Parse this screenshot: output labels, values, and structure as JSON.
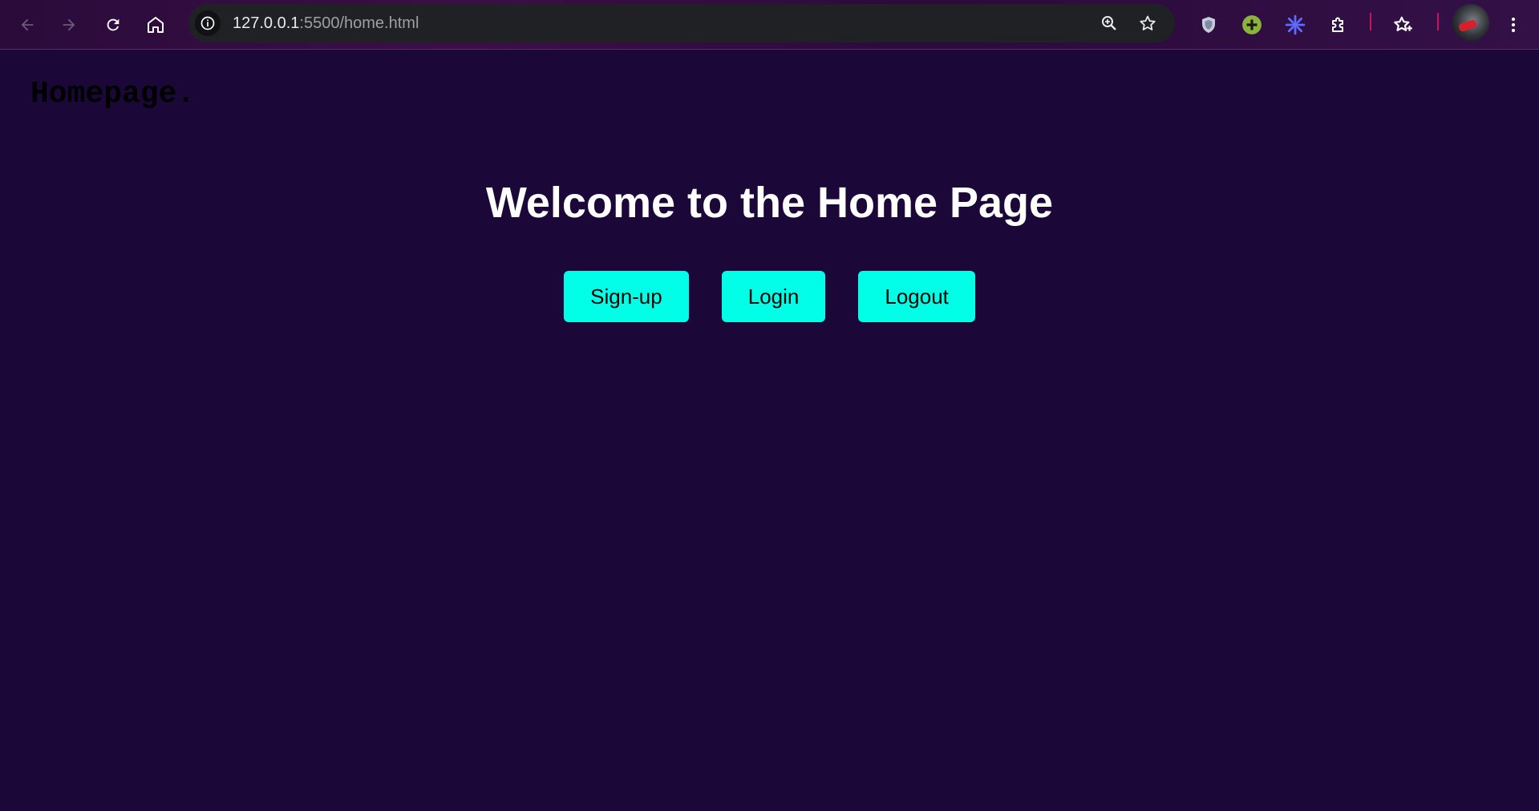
{
  "browser": {
    "url_host": "127.0.0.1",
    "url_path": ":5500/home.html",
    "icons": [
      "back-icon",
      "forward-icon",
      "reload-icon",
      "home-icon",
      "site-info-icon",
      "zoom-icon",
      "bookmark-star-icon",
      "shield-extension-icon",
      "plus-extension-icon",
      "gear-extension-icon",
      "extensions-puzzle-icon",
      "bookmarks-star-icon",
      "profile-avatar",
      "menu-kebab-icon"
    ]
  },
  "page": {
    "brand": "Homepage.",
    "heading": "Welcome to the Home Page",
    "buttons": {
      "signup": "Sign-up",
      "login": "Login",
      "logout": "Logout"
    }
  },
  "colors": {
    "background": "#1c0838",
    "button": "#00ffe6",
    "heading": "#ffffff",
    "brand": "#000000"
  }
}
